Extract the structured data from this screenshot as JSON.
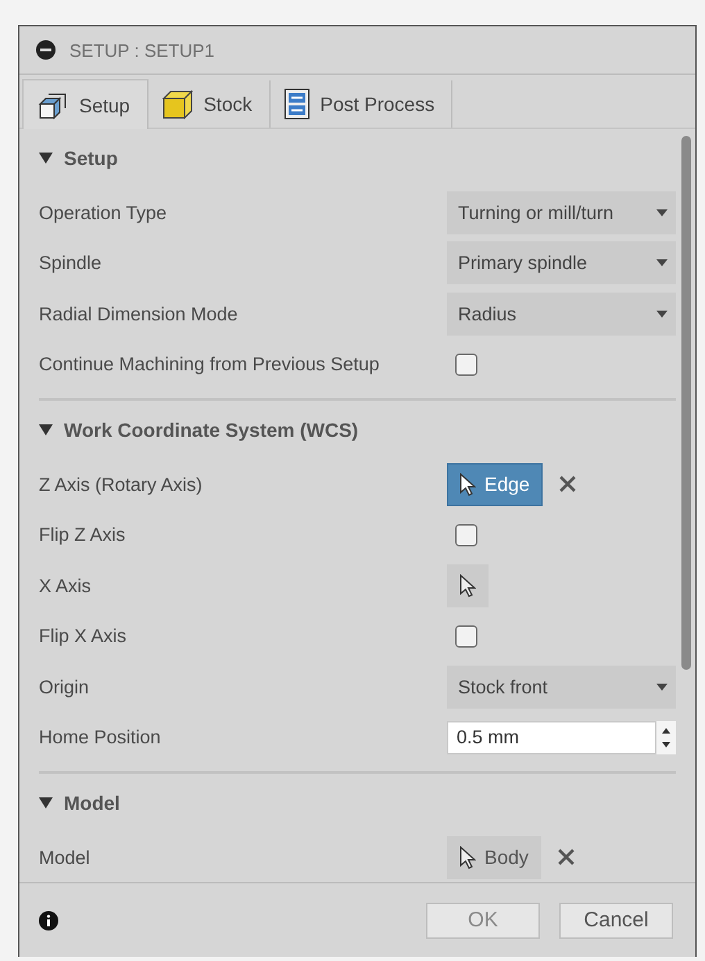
{
  "dialog": {
    "title": "SETUP : SETUP1"
  },
  "tabs": [
    {
      "label": "Setup",
      "selected": true
    },
    {
      "label": "Stock",
      "selected": false
    },
    {
      "label": "Post Process",
      "selected": false
    }
  ],
  "sections": [
    {
      "title": "Setup",
      "expanded": true,
      "rows": [
        {
          "kind": "select",
          "label": "Operation Type",
          "value": "Turning or mill/turn"
        },
        {
          "kind": "select",
          "label": "Spindle",
          "value": "Primary spindle"
        },
        {
          "kind": "select",
          "label": "Radial Dimension Mode",
          "value": "Radius"
        },
        {
          "kind": "checkbox",
          "label": "Continue Machining from Previous Setup",
          "checked": false
        }
      ]
    },
    {
      "title": "Work Coordinate System (WCS)",
      "expanded": true,
      "rows": [
        {
          "kind": "selection",
          "label": "Z Axis (Rotary Axis)",
          "value": "Edge",
          "active": true,
          "clearable": true
        },
        {
          "kind": "checkbox",
          "label": "Flip Z Axis",
          "checked": false
        },
        {
          "kind": "selection",
          "label": "X Axis",
          "active": false,
          "clearable": false
        },
        {
          "kind": "checkbox",
          "label": "Flip X Axis",
          "checked": false
        },
        {
          "kind": "select",
          "label": "Origin",
          "value": "Stock front"
        },
        {
          "kind": "number",
          "label": "Home Position",
          "value": "0.5 mm"
        }
      ]
    },
    {
      "title": "Model",
      "expanded": true,
      "rows": [
        {
          "kind": "selection",
          "label": "Model",
          "value": "Body",
          "active": false,
          "clearable": true
        }
      ]
    }
  ],
  "footer": {
    "buttons": [
      {
        "label": "OK",
        "disabled": true
      },
      {
        "label": "Cancel",
        "disabled": false
      }
    ]
  }
}
